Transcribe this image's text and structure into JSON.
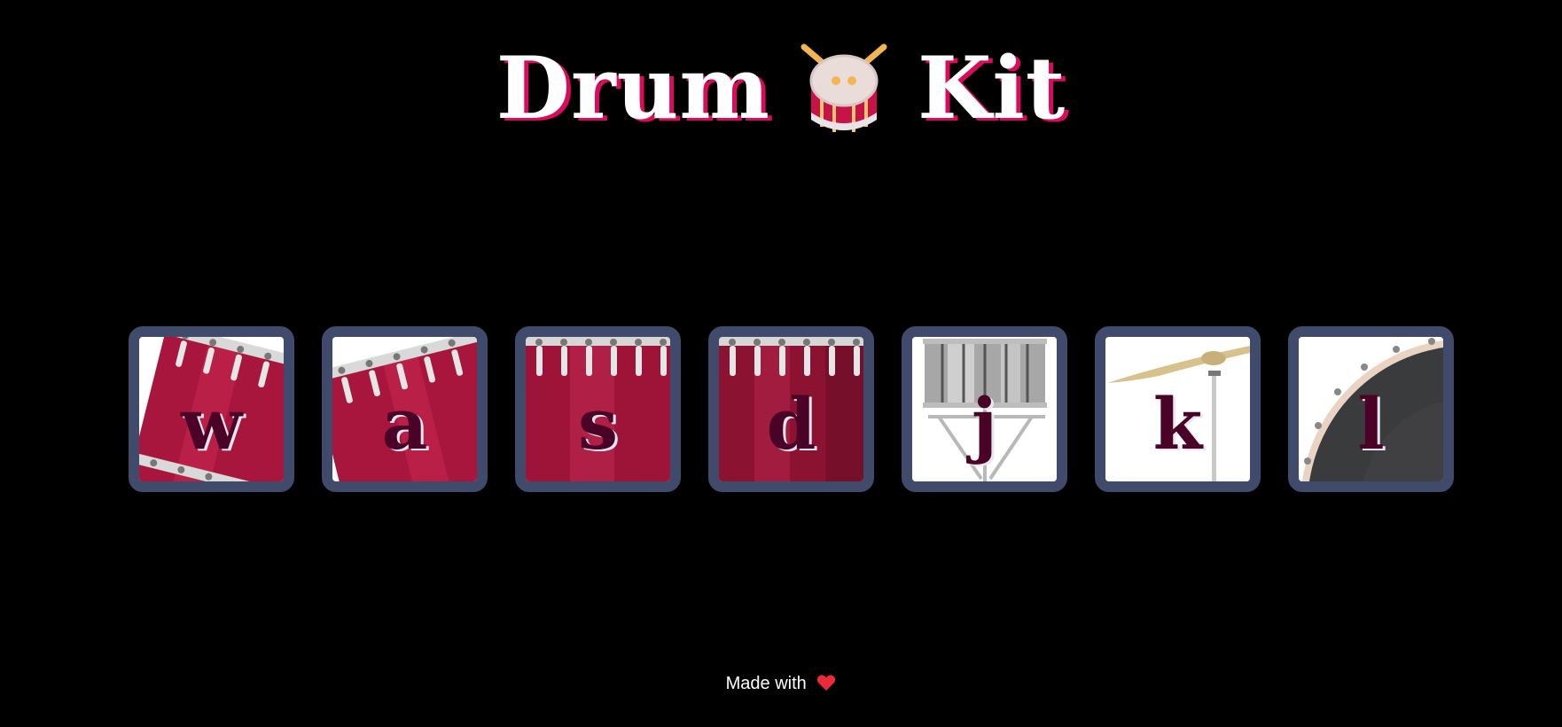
{
  "header": {
    "title_left": "Drum",
    "title_icon": "drum-icon",
    "title_right": "Kit"
  },
  "drums": [
    {
      "key": "w",
      "icon": "tom-drum-icon"
    },
    {
      "key": "a",
      "icon": "tom-drum-icon"
    },
    {
      "key": "s",
      "icon": "floor-tom-icon"
    },
    {
      "key": "d",
      "icon": "floor-tom-icon"
    },
    {
      "key": "j",
      "icon": "snare-drum-icon"
    },
    {
      "key": "k",
      "icon": "cymbal-icon"
    },
    {
      "key": "l",
      "icon": "bass-drum-icon"
    }
  ],
  "footer": {
    "text": "Made with",
    "icon": "heart-icon"
  },
  "colors": {
    "background": "#000000",
    "title": "#ffffff",
    "title_shadow": "#db0a5b",
    "drum_border": "#404b6b",
    "key_text": "#4a0326"
  }
}
